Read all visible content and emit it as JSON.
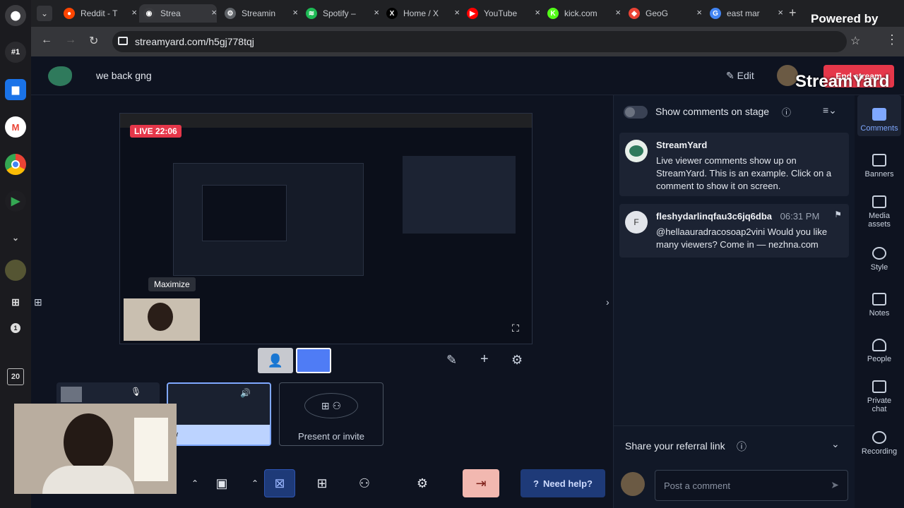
{
  "os_sidebar": {
    "badge_top": "#1",
    "counter": "20",
    "small_num": "1"
  },
  "tabs": [
    {
      "label": "Reddit - T",
      "color": "#ff4500",
      "glyph": "●"
    },
    {
      "label": "Strea",
      "color": "#3a3b3f",
      "glyph": "◉",
      "active": true
    },
    {
      "label": "Streamin",
      "color": "#5f6368",
      "glyph": "⚙"
    },
    {
      "label": "Spotify –",
      "color": "#1db954",
      "glyph": "≋"
    },
    {
      "label": "Home / X",
      "color": "#000000",
      "glyph": "X"
    },
    {
      "label": "YouTube",
      "color": "#ff0000",
      "glyph": "▶"
    },
    {
      "label": "kick.com",
      "color": "#53fc18",
      "glyph": "K"
    },
    {
      "label": "GeoG",
      "color": "#ea4335",
      "glyph": "◆"
    },
    {
      "label": "east mar",
      "color": "#4285f4",
      "glyph": "G"
    }
  ],
  "address": {
    "url": "streamyard.com/h5gj778tqj"
  },
  "powered_by": {
    "label": "Powered by",
    "brand": "StreamYard"
  },
  "header": {
    "title": "we back gng",
    "edit_label": "Edit",
    "end_stream_label": "End stream"
  },
  "stage": {
    "live_label": "LIVE 22:06",
    "maximize_tooltip": "Maximize"
  },
  "layout_bar": {
    "present_label": "Present or invite"
  },
  "thumb": {
    "label": "w"
  },
  "bottom_bar": {
    "need_help_label": "Need help?"
  },
  "comments_panel": {
    "toggle_label": "Show comments on stage",
    "comments": [
      {
        "initial": "",
        "name": "StreamYard",
        "time": "",
        "body": "Live viewer comments show up on StreamYard. This is an example. Click on a comment to show it on screen."
      },
      {
        "initial": "F",
        "name": "fleshydarlinqfau3c6jq6dba",
        "time": "06:31 PM",
        "body": "@hellaauradracosoap2vini Would you like many viewers? Come in — nezhna.com"
      }
    ],
    "referral_label": "Share your referral link",
    "comment_placeholder": "Post a comment"
  },
  "rail": [
    {
      "label": "Comments",
      "active": true
    },
    {
      "label": "Banners"
    },
    {
      "label": "Media assets"
    },
    {
      "label": "Style"
    },
    {
      "label": "Notes"
    },
    {
      "label": "People"
    },
    {
      "label": "Private chat"
    },
    {
      "label": "Recording"
    }
  ],
  "colors": {
    "accent": "#4f7cf5",
    "live": "#e5374a",
    "end_stream": "#f2b8b0",
    "need_help_bg": "#1e3a78"
  }
}
